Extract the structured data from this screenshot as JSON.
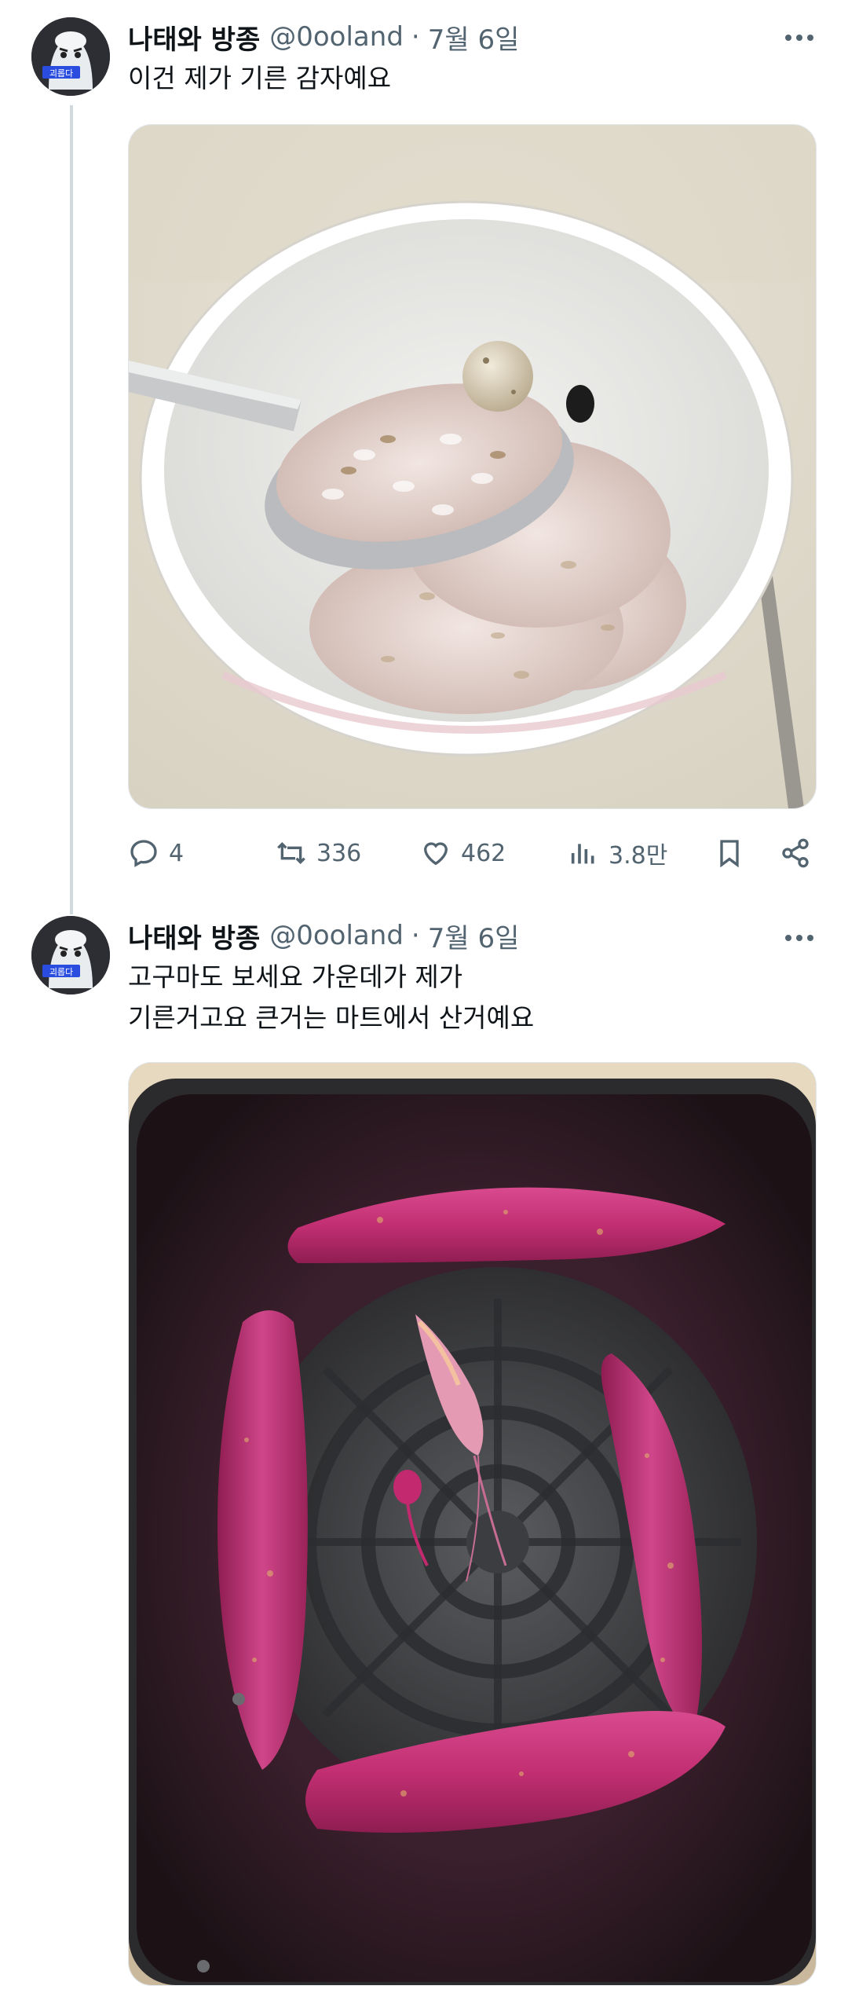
{
  "tweets": [
    {
      "author": "나태와 방종",
      "handle": "@0ooland",
      "separator": "·",
      "date": "7월 6일",
      "avatar_label": "괴롭다",
      "text_lines": [
        "이건 제가 기른 감자예요"
      ],
      "image_alt": "bowl-of-rice-with-potato",
      "actions": {
        "replies": "4",
        "retweets": "336",
        "likes": "462",
        "views": "3.8만"
      }
    },
    {
      "author": "나태와 방종",
      "handle": "@0ooland",
      "separator": "·",
      "date": "7월 6일",
      "avatar_label": "괴롭다",
      "text_lines": [
        "고구마도 보세요 가운데가 제가",
        "기른거고요 큰거는 마트에서 산거예요"
      ],
      "image_alt": "sweet-potatoes-in-air-fryer"
    }
  ],
  "colors": {
    "text_primary": "#0f1419",
    "text_secondary": "#536471",
    "thread_line": "#cfd9de"
  },
  "icons": [
    "reply-icon",
    "retweet-icon",
    "like-icon",
    "views-icon",
    "bookmark-icon",
    "share-icon",
    "more-icon"
  ]
}
